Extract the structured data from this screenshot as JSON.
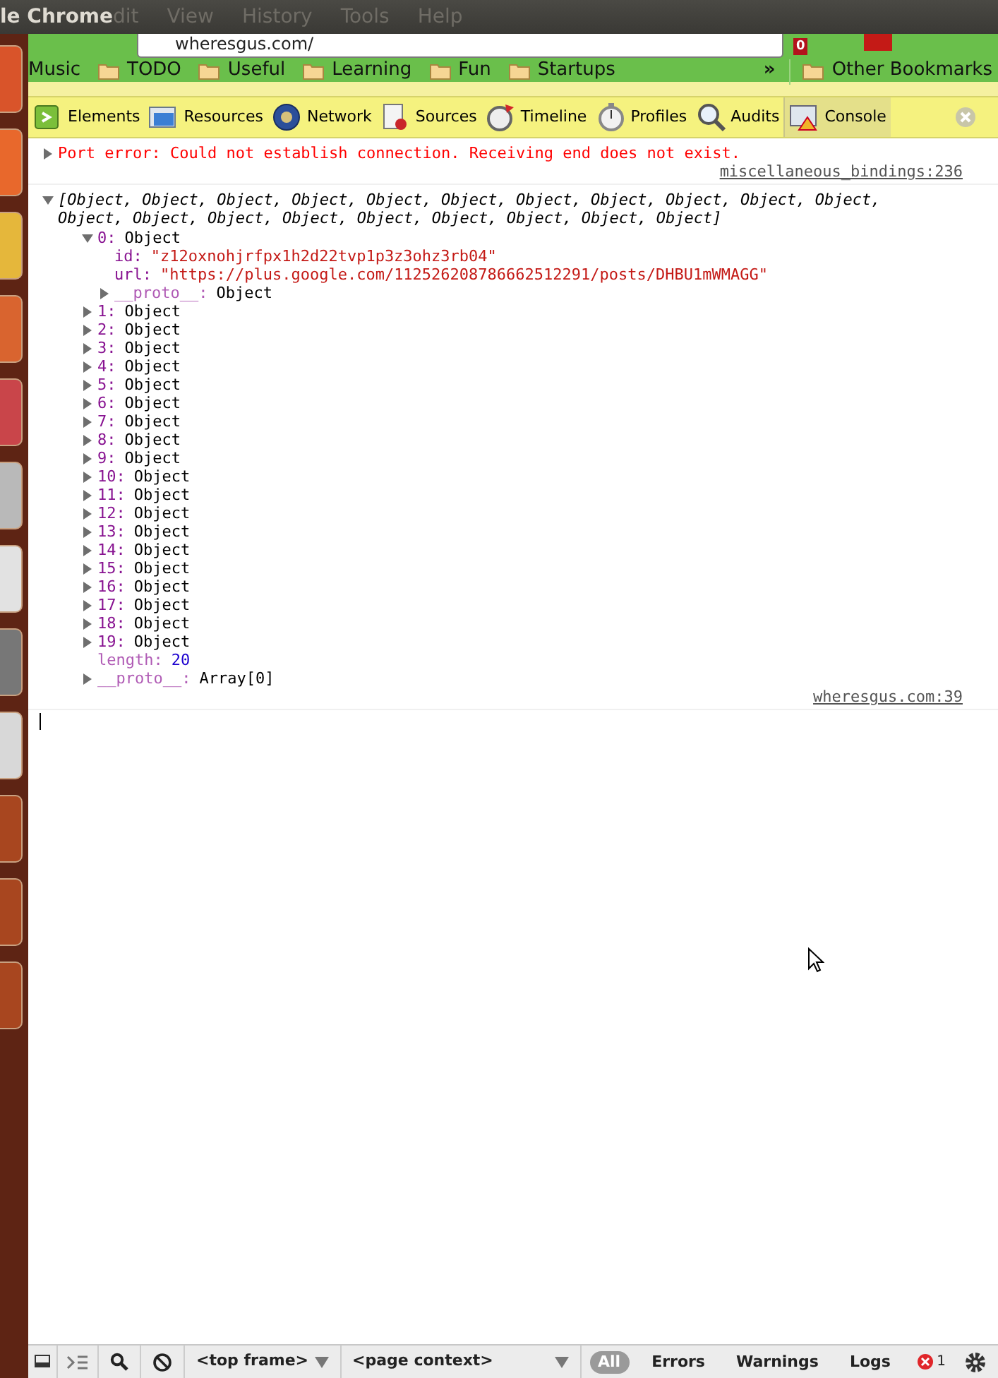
{
  "window": {
    "title": "le Chrome",
    "menu": [
      "dit",
      "View",
      "History",
      "Tools",
      "Help"
    ]
  },
  "address_bar": {
    "value": "wheresgus.com/"
  },
  "extension_badge": "0",
  "bookmarks": {
    "folders": [
      "Music",
      "TODO",
      "Useful",
      "Learning",
      "Fun",
      "Startups"
    ],
    "overflow": "»",
    "other": "Other Bookmarks"
  },
  "devtools": {
    "tabs": [
      {
        "label": "Elements",
        "selected": false
      },
      {
        "label": "Resources",
        "selected": false
      },
      {
        "label": "Network",
        "selected": false
      },
      {
        "label": "Sources",
        "selected": false
      },
      {
        "label": "Timeline",
        "selected": false
      },
      {
        "label": "Profiles",
        "selected": false
      },
      {
        "label": "Audits",
        "selected": false
      },
      {
        "label": "Console",
        "selected": true
      }
    ]
  },
  "console": {
    "messages": [
      {
        "kind": "error",
        "expanded": false,
        "text": "Port error: Could not establish connection. Receiving end does not exist.",
        "source": "miscellaneous_bindings:236"
      },
      {
        "kind": "log",
        "expanded": true,
        "text": "[Object, Object, Object, Object, Object, Object, Object, Object, Object, Object, Object, Object, Object, Object, Object, Object, Object, Object, Object, Object]",
        "source": "wheresgus.com:39",
        "children": [
          {
            "key": "0:",
            "kind": "index",
            "value": "Object",
            "expanded": true,
            "children": [
              {
                "key": "id:",
                "kind": "property",
                "value": "\"z12oxnohjrfpx1h2d22tvp1p3z3ohz3rb04\""
              },
              {
                "key": "url:",
                "kind": "property",
                "value": "\"https://plus.google.com/112526208786662512291/posts/DHBU1mWMAGG\""
              },
              {
                "key": "__proto__:",
                "kind": "internal",
                "value": "Object",
                "expanded": false
              }
            ]
          },
          {
            "key": "1:",
            "kind": "index",
            "value": "Object",
            "expanded": false
          },
          {
            "key": "2:",
            "kind": "index",
            "value": "Object",
            "expanded": false
          },
          {
            "key": "3:",
            "kind": "index",
            "value": "Object",
            "expanded": false
          },
          {
            "key": "4:",
            "kind": "index",
            "value": "Object",
            "expanded": false
          },
          {
            "key": "5:",
            "kind": "index",
            "value": "Object",
            "expanded": false
          },
          {
            "key": "6:",
            "kind": "index",
            "value": "Object",
            "expanded": false
          },
          {
            "key": "7:",
            "kind": "index",
            "value": "Object",
            "expanded": false
          },
          {
            "key": "8:",
            "kind": "index",
            "value": "Object",
            "expanded": false
          },
          {
            "key": "9:",
            "kind": "index",
            "value": "Object",
            "expanded": false
          },
          {
            "key": "10:",
            "kind": "index",
            "value": "Object",
            "expanded": false
          },
          {
            "key": "11:",
            "kind": "index",
            "value": "Object",
            "expanded": false
          },
          {
            "key": "12:",
            "kind": "index",
            "value": "Object",
            "expanded": false
          },
          {
            "key": "13:",
            "kind": "index",
            "value": "Object",
            "expanded": false
          },
          {
            "key": "14:",
            "kind": "index",
            "value": "Object",
            "expanded": false
          },
          {
            "key": "15:",
            "kind": "index",
            "value": "Object",
            "expanded": false
          },
          {
            "key": "16:",
            "kind": "index",
            "value": "Object",
            "expanded": false
          },
          {
            "key": "17:",
            "kind": "index",
            "value": "Object",
            "expanded": false
          },
          {
            "key": "18:",
            "kind": "index",
            "value": "Object",
            "expanded": false
          },
          {
            "key": "19:",
            "kind": "index",
            "value": "Object",
            "expanded": false
          },
          {
            "key": "length:",
            "kind": "internal-plain",
            "value": "20"
          },
          {
            "key": "__proto__:",
            "kind": "internal",
            "value": "Array[0]",
            "expanded": false
          }
        ]
      }
    ]
  },
  "status_bar": {
    "frame": "<top frame>",
    "context": "<page context>",
    "filters": [
      {
        "label": "All",
        "selected": true
      },
      {
        "label": "Errors",
        "selected": false
      },
      {
        "label": "Warnings",
        "selected": false
      },
      {
        "label": "Logs",
        "selected": false
      }
    ],
    "error_count": "1"
  }
}
